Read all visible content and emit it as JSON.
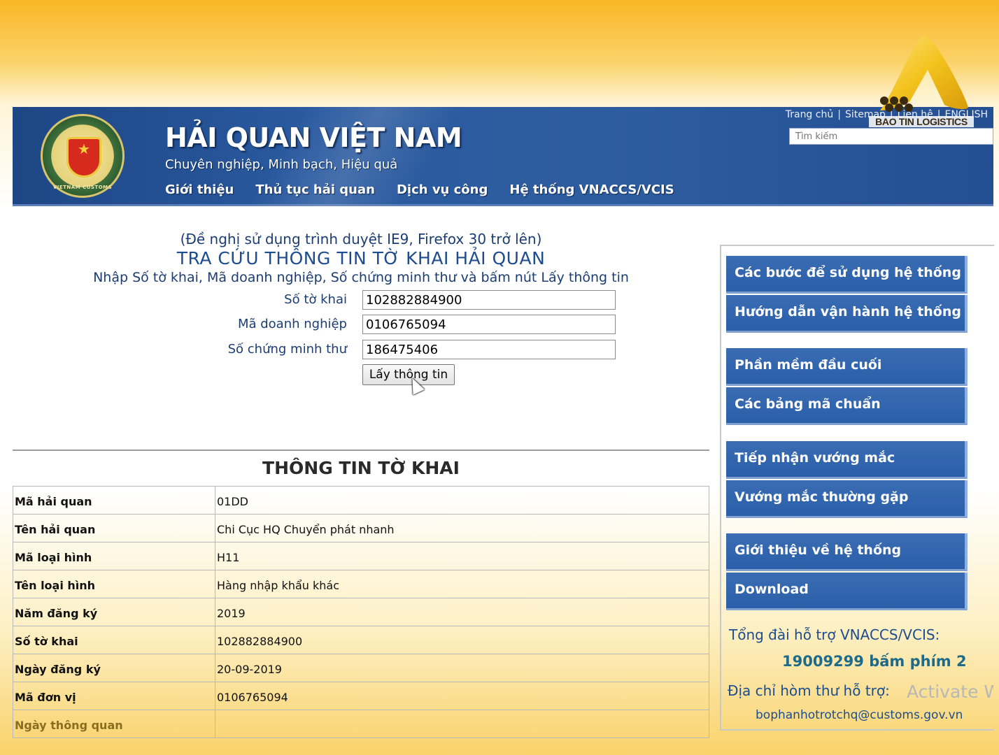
{
  "header": {
    "emblem_star": "★",
    "emblem_text": "VIETNAM CUSTOMS",
    "title": "HẢI QUAN VIỆT NAM",
    "subtitle": "Chuyên nghiệp, Minh bạch, Hiệu quả",
    "nav": [
      "Giới thiệu",
      "Thủ tục hải quan",
      "Dịch vụ công",
      "Hệ thống VNACCS/VCIS"
    ],
    "top_links": [
      "Trang chủ",
      "Sitemap",
      "Liên hệ",
      "ENGLISH"
    ],
    "search_placeholder": "Tìm kiếm"
  },
  "watermark_logo": {
    "text": "BAO TIN LOGISTICS",
    "colors": [
      "#f3c21c",
      "#d89b0a",
      "#3a2a10"
    ]
  },
  "form": {
    "hint": "(Đề nghị sử dụng trình duyệt IE9, Firefox 30 trở lên)",
    "title": "TRA CỨU THÔNG TIN TỜ KHAI HẢI QUAN",
    "instructions": "Nhập Số tờ khai, Mã doanh nghiệp, Số chứng minh thư và bấm nút Lấy thông tin",
    "fields": [
      {
        "label": "Số tờ khai",
        "value": "102882884900"
      },
      {
        "label": "Mã doanh nghiệp",
        "value": "0106765094"
      },
      {
        "label": "Số chứng minh thư",
        "value": "186475406"
      }
    ],
    "submit_label": "Lấy thông tin"
  },
  "result": {
    "title": "THÔNG TIN TỜ KHAI",
    "rows": [
      {
        "key": "Mã hải quan",
        "value": "01DD"
      },
      {
        "key": "Tên hải quan",
        "value": "Chi Cục HQ Chuyển phát nhanh"
      },
      {
        "key": "Mã loại hình",
        "value": "H11"
      },
      {
        "key": "Tên loại hình",
        "value": "Hàng nhập khẩu khác"
      },
      {
        "key": "Năm đăng ký",
        "value": "2019"
      },
      {
        "key": "Số tờ khai",
        "value": "102882884900"
      },
      {
        "key": "Ngày đăng ký",
        "value": "20-09-2019"
      },
      {
        "key": "Mã đơn vị",
        "value": "0106765094"
      },
      {
        "key": "Ngày thông quan",
        "value": ""
      }
    ]
  },
  "sidebar": {
    "buttons": [
      "Các bước để sử dụng hệ thống",
      "Hướng dẫn vận hành hệ thống",
      "Phần mềm đầu cuối",
      "Các bảng mã chuẩn",
      "Tiếp nhận vướng mắc",
      "Vướng mắc thường gặp",
      "Giới thiệu về hệ thống",
      "Download"
    ],
    "support_title": "Tổng đài hỗ trợ VNACCS/VCIS:",
    "support_phone": "19009299 bấm phím 2",
    "mail_label": "Địa chỉ hòm thư hỗ trợ:",
    "mail": "bophanhotrotchq@customs.gov.vn"
  },
  "os_overlay": {
    "activate_text": "Activate W"
  },
  "colors": {
    "banner_blue": "#2b5aa0",
    "sidebar_button": "#2f62aa",
    "heading_blue": "#1d4d8e"
  }
}
